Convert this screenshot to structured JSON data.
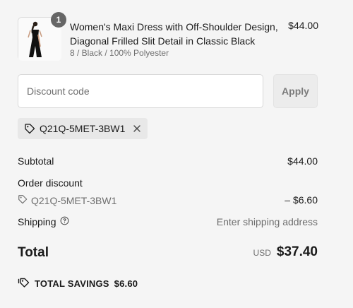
{
  "product": {
    "quantity": "1",
    "name": "Women's Maxi Dress with Off-Shoulder Design, Diagonal Frilled Slit Detail in Classic Black",
    "variant": "8 / Black / 100% Polyester",
    "price": "$44.00",
    "image_icon": "dress-thumbnail"
  },
  "discount": {
    "placeholder": "Discount code",
    "apply_label": "Apply",
    "applied_code": "Q21Q-5MET-3BW1"
  },
  "summary": {
    "subtotal_label": "Subtotal",
    "subtotal_value": "$44.00",
    "order_discount_label": "Order discount",
    "discount_code": "Q21Q-5MET-3BW1",
    "discount_value": "– $6.60",
    "shipping_label": "Shipping",
    "shipping_value": "Enter shipping address",
    "total_label": "Total",
    "currency": "USD",
    "total_value": "$37.40",
    "savings_label": "TOTAL SAVINGS",
    "savings_value": "$6.60"
  }
}
